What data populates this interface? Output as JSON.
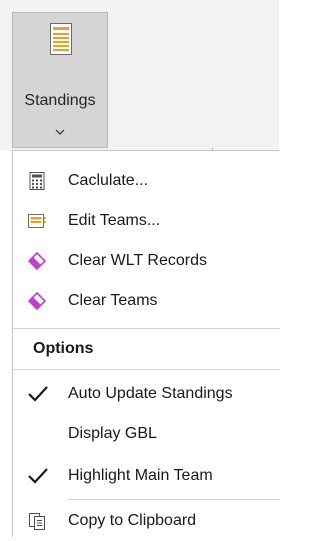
{
  "ribbon": {
    "standings_button": {
      "label": "Standings",
      "icon": "standings-sheet-icon",
      "dropdown_icon": "chevron-down-icon"
    }
  },
  "menu": {
    "items": [
      {
        "label": "Caclulate...",
        "icon": "calculator-icon"
      },
      {
        "label": "Edit Teams...",
        "icon": "edit-teams-icon"
      },
      {
        "label": "Clear WLT Records",
        "icon": "eraser-icon"
      },
      {
        "label": "Clear Teams",
        "icon": "eraser-icon"
      }
    ],
    "options_header": "Options",
    "options": [
      {
        "label": "Auto Update Standings",
        "checked": true
      },
      {
        "label": "Display GBL",
        "checked": false
      },
      {
        "label": "Highlight Main Team",
        "checked": true
      }
    ],
    "copy": {
      "label": "Copy to Clipboard",
      "icon": "copy-icon"
    }
  },
  "colors": {
    "ribbon_button_bg": "#d5d5d5",
    "eraser_accent": "#c23fd1",
    "icon_orange": "#f0a020"
  }
}
